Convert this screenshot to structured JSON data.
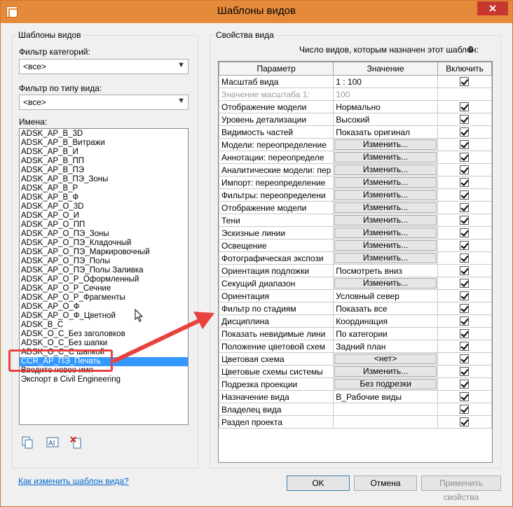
{
  "window": {
    "title": "Шаблоны видов",
    "close_label": "✕"
  },
  "left": {
    "group_label": "Шаблоны видов",
    "category_filter_label": "Фильтр категорий:",
    "category_filter_value": "<все>",
    "type_filter_label": "Фильтр по типу вида:",
    "type_filter_value": "<все>",
    "names_label": "Имена:",
    "names": [
      "ADSK_AP_B_3D",
      "ADSK_AP_B_Витражи",
      "ADSK_AP_B_И",
      "ADSK_AP_B_ПП",
      "ADSK_AP_B_ПЭ",
      "ADSK_AP_B_ПЭ_Зоны",
      "ADSK_AP_B_P",
      "ADSK_AP_B_Ф",
      "ADSK_AP_O_3D",
      "ADSK_AP_O_И",
      "ADSK_AP_O_ПП",
      "ADSK_AP_O_ПЭ_Зоны",
      "ADSK_AP_O_ПЭ_Кладочный",
      "ADSK_AP_O_ПЭ_Маркировочный",
      "ADSK_AP_O_ПЭ_Полы",
      "ADSK_AP_O_ПЭ_Полы Заливка",
      "ADSK_AP_O_P_Оформленный",
      "ADSK_AP_O_P_Сечние",
      "ADSK_AP_O_P_Фрагменты",
      "ADSK_AP_O_Ф",
      "ADSK_AP_O_Ф_Цветной",
      "ADSK_B_C",
      "ADSK_O_C_Без заголовков",
      "ADSK_O_C_Без шапки",
      "ADSK_O_C_С шапкой",
      "CCR_AP_ПЭ_Печать",
      "Введите новое имя",
      "Экспорт в Civil Engineering"
    ],
    "selected_index": 25
  },
  "right": {
    "group_label": "Свойства вида",
    "count_label": "Число видов, которым назначен этот шаблон:",
    "count_value": "0",
    "columns": {
      "param": "Параметр",
      "value": "Значение",
      "include": "Включить"
    },
    "rows": [
      {
        "param": "Масштаб вида",
        "value": "1 : 100",
        "button": false,
        "include": true,
        "dim": false
      },
      {
        "param": "Значение масштаба   1:",
        "value": "100",
        "button": false,
        "include": null,
        "dim": true
      },
      {
        "param": "Отображение модели",
        "value": "Нормально",
        "button": false,
        "include": true,
        "dim": false
      },
      {
        "param": "Уровень детализации",
        "value": "Высокий",
        "button": false,
        "include": true,
        "dim": false
      },
      {
        "param": "Видимость частей",
        "value": "Показать оригинал",
        "button": false,
        "include": true,
        "dim": false
      },
      {
        "param": "Модели: переопределение",
        "value": "Изменить...",
        "button": true,
        "include": true,
        "dim": false
      },
      {
        "param": "Аннотации: переопределе",
        "value": "Изменить...",
        "button": true,
        "include": true,
        "dim": false
      },
      {
        "param": "Аналитические модели: пер",
        "value": "Изменить...",
        "button": true,
        "include": true,
        "dim": false
      },
      {
        "param": "Импорт: переопределение",
        "value": "Изменить...",
        "button": true,
        "include": true,
        "dim": false
      },
      {
        "param": "Фильтры: переопределени",
        "value": "Изменить...",
        "button": true,
        "include": true,
        "dim": false
      },
      {
        "param": "Отображение модели",
        "value": "Изменить...",
        "button": true,
        "include": true,
        "dim": false
      },
      {
        "param": "Тени",
        "value": "Изменить...",
        "button": true,
        "include": true,
        "dim": false
      },
      {
        "param": "Эскизные линии",
        "value": "Изменить...",
        "button": true,
        "include": true,
        "dim": false
      },
      {
        "param": "Освещение",
        "value": "Изменить...",
        "button": true,
        "include": true,
        "dim": false
      },
      {
        "param": "Фотографическая экспози",
        "value": "Изменить...",
        "button": true,
        "include": true,
        "dim": false
      },
      {
        "param": "Ориентация подложки",
        "value": "Посмотреть вниз",
        "button": false,
        "include": true,
        "dim": false
      },
      {
        "param": "Секущий диапазон",
        "value": "Изменить...",
        "button": true,
        "include": true,
        "dim": false
      },
      {
        "param": "Ориентация",
        "value": "Условный север",
        "button": false,
        "include": true,
        "dim": false
      },
      {
        "param": "Фильтр по стадиям",
        "value": "Показать все",
        "button": false,
        "include": true,
        "dim": false
      },
      {
        "param": "Дисциплина",
        "value": "Координация",
        "button": false,
        "include": true,
        "dim": false
      },
      {
        "param": "Показать невидимые лини",
        "value": "По категории",
        "button": false,
        "include": true,
        "dim": false
      },
      {
        "param": "Положение цветовой схем",
        "value": "Задний план",
        "button": false,
        "include": true,
        "dim": false
      },
      {
        "param": "Цветовая схема",
        "value": "<нет>",
        "button": true,
        "include": true,
        "dim": false
      },
      {
        "param": "Цветовые схемы системы",
        "value": "Изменить...",
        "button": true,
        "include": true,
        "dim": false
      },
      {
        "param": "Подрезка проекции",
        "value": "Без подрезки",
        "button": true,
        "include": true,
        "dim": false
      },
      {
        "param": "Назначение вида",
        "value": "В_Рабочие виды",
        "button": false,
        "include": true,
        "dim": false
      },
      {
        "param": "Владелец вида",
        "value": "",
        "button": false,
        "include": true,
        "dim": false
      },
      {
        "param": "Раздел проекта",
        "value": "",
        "button": false,
        "include": true,
        "dim": false
      }
    ]
  },
  "footer": {
    "help_link": "Как изменить шаблон вида?",
    "ok": "OK",
    "cancel": "Отмена",
    "apply": "Применить свойства"
  },
  "colors": {
    "titlebar": "#e58a3a",
    "annotation": "#e7423e",
    "selection": "#3399ff"
  }
}
